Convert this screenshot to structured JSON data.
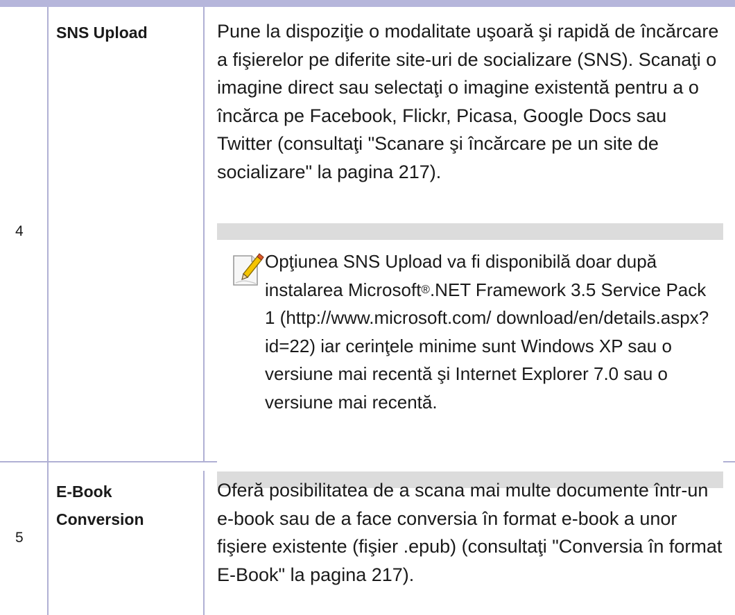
{
  "rows": [
    {
      "number": "4",
      "feature": "SNS Upload",
      "description": "Pune la dispoziţie o modalitate uşoară şi rapidă de încărcare a fişierelor pe diferite site-uri de socializare (SNS). Scanaţi o imagine direct sau selectaţi o imagine existentă pentru a o încărca pe Facebook, Flickr, Picasa, Google Docs sau Twitter (consultaţi \"Scanare şi încărcare pe un site de socializare\" la pagina 217).",
      "note": {
        "icon": "note-pencil-icon",
        "text_before": "Opţiunea SNS Upload va fi disponibilă doar după instalarea Microsoft",
        "reg_mark": "®",
        "text_after": ".NET Framework 3.5 Service Pack 1 (http://www.microsoft.com/ download/en/details.aspx?id=22) iar cerinţele minime sunt Windows XP sau o versiune mai recentă şi Internet Explorer 7.0 sau o versiune mai recentă."
      }
    },
    {
      "number": "5",
      "feature": "E-Book Conversion",
      "description": "Oferă posibilitatea de a scana mai multe documente într-un e-book sau de a face conversia în format e-book a unor fişiere existente (fişier .epub) (consultaţi \"Conversia în format E-Book\" la pagina 217)."
    }
  ]
}
